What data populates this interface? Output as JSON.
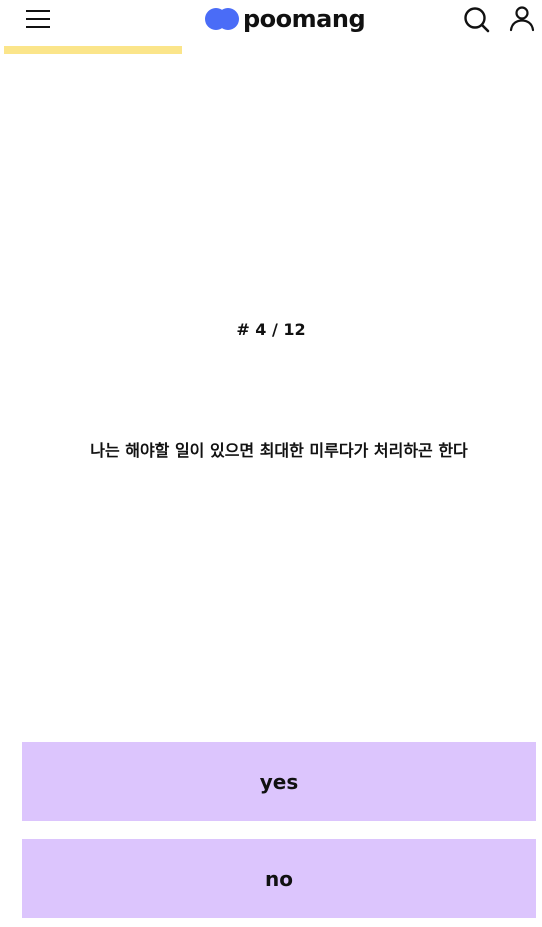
{
  "header": {
    "logo_text": "poomang",
    "menu_icon": "hamburger-menu-icon",
    "search_icon": "search-icon",
    "user_icon": "user-icon",
    "logo_color": "#4a6cf7"
  },
  "progress": {
    "current": 4,
    "total": 12,
    "fraction": 0.333,
    "fill_color": "#fbe58a"
  },
  "quiz": {
    "counter_text": "# 4 / 12",
    "question_text": "나는 해야할 일이 있으면 최대한 미루다가 처리하곤 한다"
  },
  "answers": {
    "yes_label": "yes",
    "no_label": "no",
    "button_color": "#dcc5fd"
  }
}
